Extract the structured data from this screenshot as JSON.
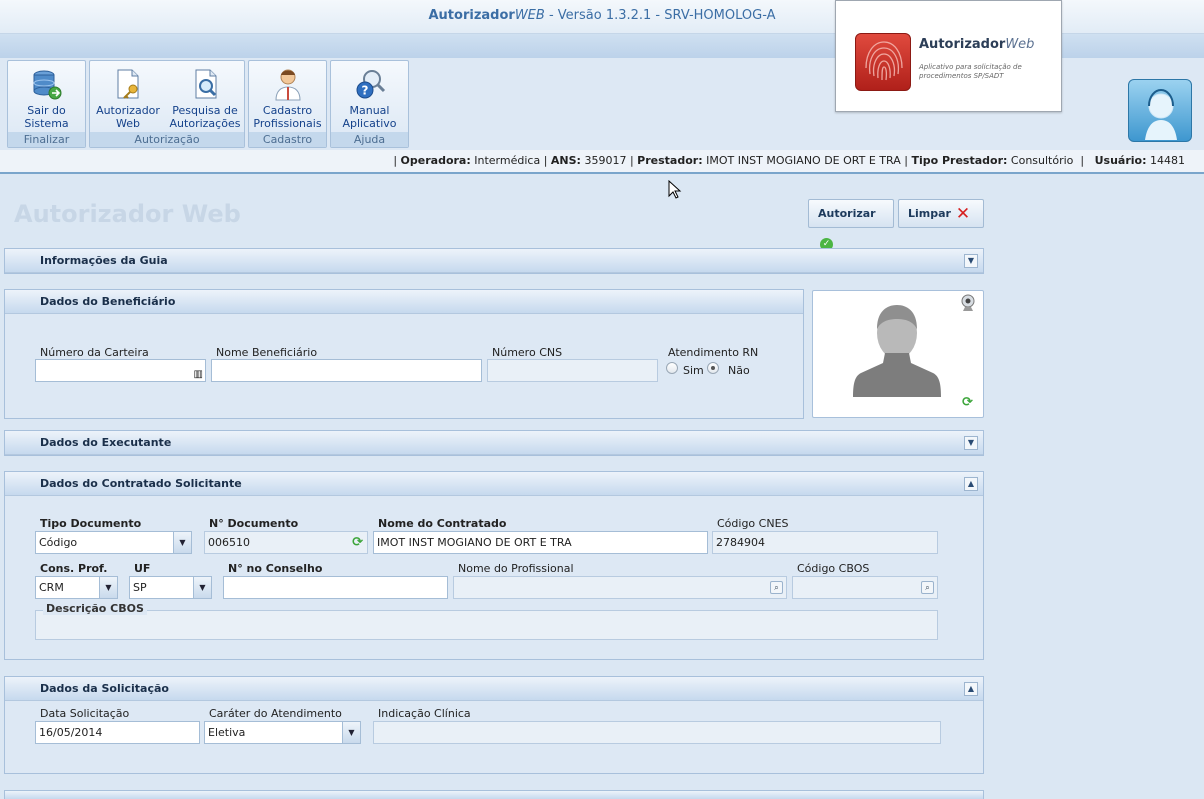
{
  "app": {
    "title_brand": "Autorizador",
    "title_web": "WEB",
    "title_rest": " - Versão 1.3.2.1 - SRV-HOMOLOG-A"
  },
  "ribbon": {
    "groups": [
      {
        "label": "Finalizar",
        "buttons": [
          {
            "line1": "Sair do",
            "line2": "Sistema",
            "icon": "database-exit-icon"
          }
        ]
      },
      {
        "label": "Autorização",
        "buttons": [
          {
            "line1": "Autorizador",
            "line2": "Web",
            "icon": "document-key-icon"
          },
          {
            "line1": "Pesquisa de",
            "line2": "Autorizações",
            "icon": "document-search-icon"
          }
        ]
      },
      {
        "label": "Cadastro",
        "buttons": [
          {
            "line1": "Cadastro",
            "line2": "Profissionais",
            "icon": "doctor-icon"
          }
        ]
      },
      {
        "label": "Ajuda",
        "buttons": [
          {
            "line1": "Manual",
            "line2": "Aplicativo",
            "icon": "help-magnifier-icon"
          }
        ]
      }
    ]
  },
  "logo": {
    "brand": "Autorizador",
    "web": "Web",
    "subtitle": "Aplicativo para solicitação de procedimentos SP/SADT"
  },
  "infobar": {
    "operadora_label": "Operadora:",
    "operadora": "Intermédica",
    "ans_label": "ANS:",
    "ans": "359017",
    "prestador_label": "Prestador:",
    "prestador": "IMOT INST MOGIANO DE ORT E TRA",
    "tipo_label": "Tipo Prestador:",
    "tipo": "Consultório",
    "usuario_label": "Usuário:",
    "usuario": "14481"
  },
  "page": {
    "title": "Autorizador Web",
    "autorizar_label": "Autorizar",
    "limpar_label": "Limpar"
  },
  "panels": {
    "guia": {
      "title": "Informações da Guia"
    },
    "beneficiario": {
      "title": "Dados do Beneficiário",
      "carteira_label": "Número da Carteira",
      "carteira_value": "",
      "nome_label": "Nome Beneficiário",
      "nome_value": "",
      "cns_label": "Número CNS",
      "cns_value": "",
      "rn_label": "Atendimento RN",
      "rn_sim": "Sim",
      "rn_nao": "Não",
      "rn_selected": "Não"
    },
    "executante": {
      "title": "Dados do Executante"
    },
    "contratado": {
      "title": "Dados do Contratado Solicitante",
      "tipo_doc_label": "Tipo Documento",
      "tipo_doc_value": "Código",
      "num_doc_label": "N° Documento",
      "num_doc_value": "006510",
      "nome_contratado_label": "Nome do Contratado",
      "nome_contratado_value": "IMOT INST MOGIANO DE ORT E TRA",
      "cnes_label": "Código CNES",
      "cnes_value": "2784904",
      "cons_prof_label": "Cons. Prof.",
      "cons_prof_value": "CRM",
      "uf_label": "UF",
      "uf_value": "SP",
      "num_conselho_label": "N° no Conselho",
      "num_conselho_value": "",
      "nome_prof_label": "Nome do Profissional",
      "nome_prof_value": "",
      "cbos_label": "Código CBOS",
      "cbos_value": "",
      "desc_cbos_label": "Descrição CBOS"
    },
    "solicitacao": {
      "title": "Dados da Solicitação",
      "data_label": "Data Solicitação",
      "data_value": "16/05/2014",
      "carater_label": "Caráter do Atendimento",
      "carater_value": "Eletiva",
      "indicacao_label": "Indicação Clínica",
      "indicacao_value": ""
    }
  },
  "colors": {
    "accent": "#15428b",
    "panel_bg": "#dde8f4",
    "brand_red": "#c0271e"
  }
}
